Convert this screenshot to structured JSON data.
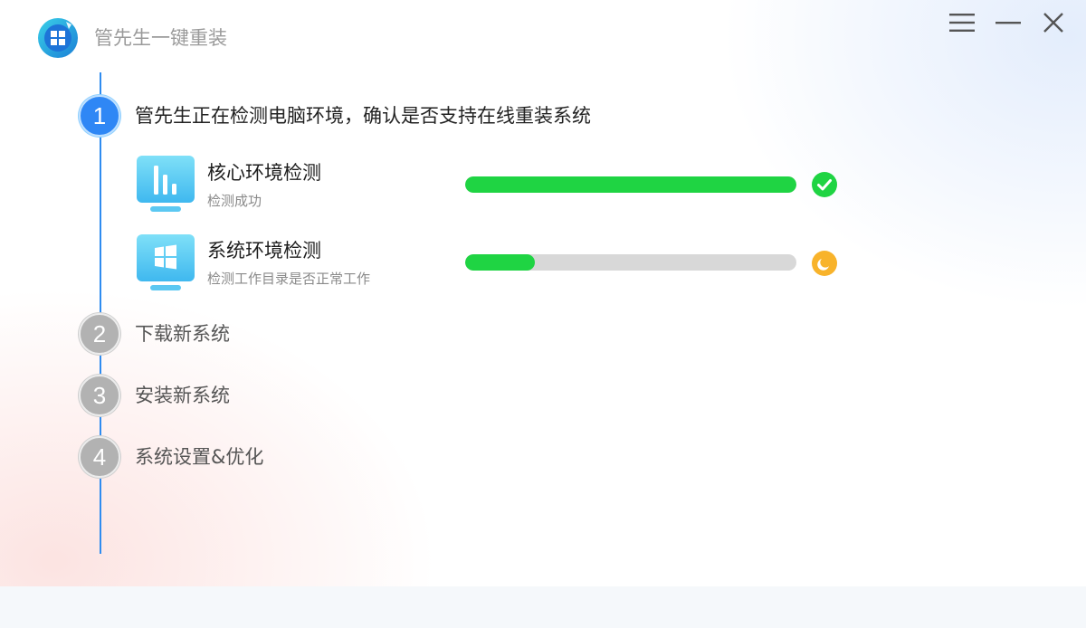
{
  "app": {
    "title": "管先生一键重装",
    "logo_icon": "windows-refresh-logo-icon",
    "window_controls": [
      "menu-icon",
      "minimize-icon",
      "close-icon"
    ]
  },
  "colors": {
    "accent_blue": "#2f87f5",
    "progress_green": "#1fd443",
    "success_green": "#1fd443",
    "pending_orange": "#f8b32b",
    "inactive_gray": "#b2b2b2"
  },
  "steps": [
    {
      "number": "1",
      "label": "管先生正在检测电脑环境，确认是否支持在线重装系统",
      "state": "active"
    },
    {
      "number": "2",
      "label": "下载新系统",
      "state": "pending"
    },
    {
      "number": "3",
      "label": "安装新系统",
      "state": "pending"
    },
    {
      "number": "4",
      "label": "系统设置&优化",
      "state": "pending"
    }
  ],
  "checks": [
    {
      "title": "核心环境检测",
      "status": "检测成功",
      "progress": 1.0,
      "icon": "bar-chart-monitor-icon",
      "result_icon": "check-circle-icon"
    },
    {
      "title": "系统环境检测",
      "status": "检测工作目录是否正常工作",
      "progress": 0.21,
      "icon": "windows-monitor-icon",
      "result_icon": "clock-icon"
    }
  ]
}
